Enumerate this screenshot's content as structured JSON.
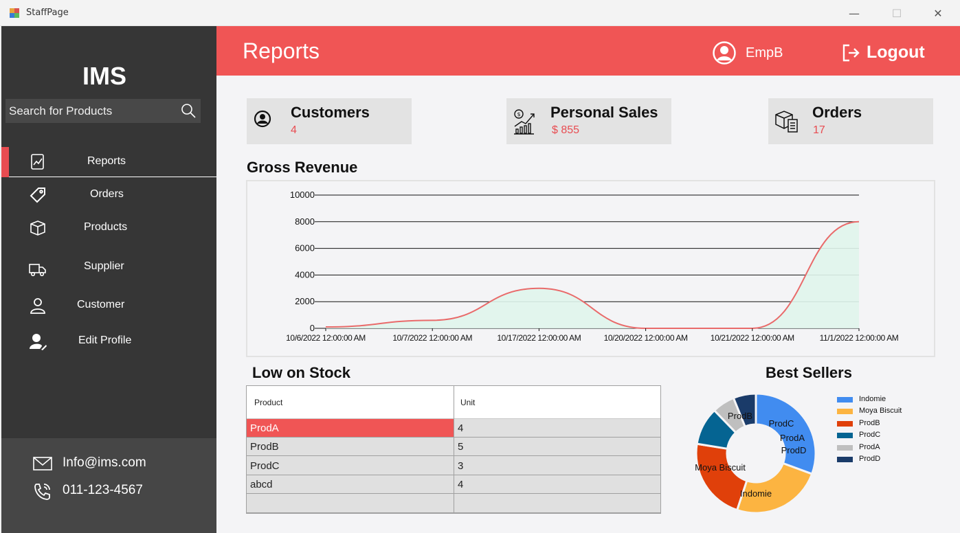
{
  "window": {
    "title": "StaffPage"
  },
  "sidebar": {
    "brand": "IMS",
    "search_placeholder": "Search for Products",
    "items": [
      {
        "label": "Reports",
        "icon": "report-chart-icon",
        "active": true
      },
      {
        "label": "Orders",
        "icon": "tag-icon",
        "active": false
      },
      {
        "label": "Products",
        "icon": "box-icon",
        "active": false
      },
      {
        "label": "Supplier",
        "icon": "truck-icon",
        "active": false
      },
      {
        "label": "Customer",
        "icon": "user-icon",
        "active": false
      },
      {
        "label": "Edit Profile",
        "icon": "user-edit-icon",
        "active": false
      }
    ],
    "contact": {
      "email": "Info@ims.com",
      "phone": "011-123-4567"
    }
  },
  "header": {
    "title": "Reports",
    "user": "EmpB",
    "logout_label": "Logout"
  },
  "stats": [
    {
      "title": "Customers",
      "value": "4",
      "icon": "user-circle-icon"
    },
    {
      "title": "Personal Sales",
      "value": "$ 855",
      "icon": "sales-growth-icon"
    },
    {
      "title": "Orders",
      "value": "17",
      "icon": "package-list-icon"
    }
  ],
  "revenue": {
    "title": "Gross Revenue"
  },
  "low_stock": {
    "title": "Low on Stock",
    "columns": [
      "Product",
      "Unit"
    ],
    "rows": [
      [
        "ProdA",
        "4"
      ],
      [
        "ProdB",
        "5"
      ],
      [
        "ProdC",
        "3"
      ],
      [
        "abcd",
        "4"
      ]
    ],
    "selected_row": 0
  },
  "best_sellers": {
    "title": "Best Sellers"
  },
  "colors": {
    "accent": "#f05555",
    "sidebar": "#363636",
    "line": "#e96a6a",
    "area": "#e0f5ec"
  },
  "chart_data": [
    {
      "type": "area",
      "title": "Gross Revenue",
      "x": [
        "10/6/2022 12:00:00 AM",
        "10/7/2022 12:00:00 AM",
        "10/17/2022 12:00:00 AM",
        "10/20/2022 12:00:00 AM",
        "10/21/2022 12:00:00 AM",
        "11/1/2022 12:00:00 AM"
      ],
      "values": [
        100,
        600,
        3000,
        0,
        0,
        8000
      ],
      "ylim": [
        0,
        10000
      ],
      "yticks": [
        "0",
        "2000",
        "4000",
        "6000",
        "8000",
        "10000"
      ],
      "grid": true,
      "smooth": true
    },
    {
      "type": "pie",
      "donut": true,
      "title": "Best Sellers",
      "categories": [
        "Indomie",
        "Moya Biscuit",
        "ProdB",
        "ProdC",
        "ProdA",
        "ProdD"
      ],
      "values": [
        30,
        24,
        22,
        10,
        6,
        6
      ],
      "colors": [
        "#418cf0",
        "#fcb441",
        "#e0400a",
        "#056492",
        "#bfbfbf",
        "#1a3b69"
      ],
      "legend": "right"
    }
  ]
}
